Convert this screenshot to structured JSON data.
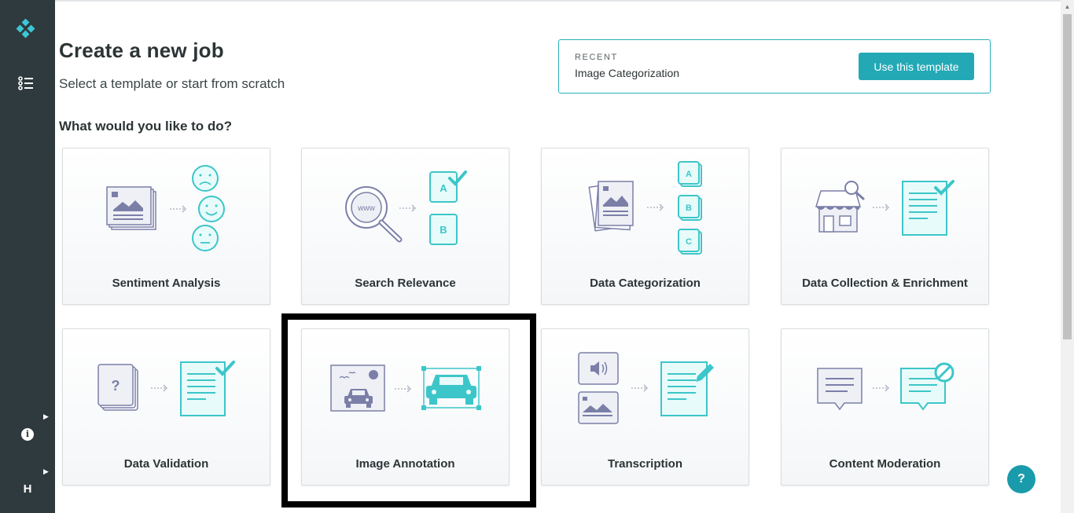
{
  "sidebar": {
    "logo_icon": "diamond-logo-icon",
    "list_icon": "task-list-icon",
    "info_glyph": "i",
    "user_initial": "H"
  },
  "header": {
    "title": "Create a new job",
    "subtitle": "Select a template or start from scratch",
    "question": "What would you like to do?"
  },
  "recent": {
    "label": "RECENT",
    "template_name": "Image Categorization",
    "button_label": "Use this template"
  },
  "templates": [
    {
      "label": "Sentiment Analysis",
      "icon": "sentiment-analysis-icon"
    },
    {
      "label": "Search Relevance",
      "icon": "search-relevance-icon"
    },
    {
      "label": "Data Categorization",
      "icon": "data-categorization-icon"
    },
    {
      "label": "Data Collection & Enrichment",
      "icon": "data-collection-icon"
    },
    {
      "label": "Data Validation",
      "icon": "data-validation-icon"
    },
    {
      "label": "Image Annotation",
      "icon": "image-annotation-icon"
    },
    {
      "label": "Transcription",
      "icon": "transcription-icon"
    },
    {
      "label": "Content Moderation",
      "icon": "content-moderation-icon"
    }
  ],
  "help_button": "?",
  "colors": {
    "accent": "#23a9b6",
    "sidebar": "#2e3a3d",
    "icon_teal": "#3cc6c9",
    "icon_gray": "#7b7fa8"
  }
}
